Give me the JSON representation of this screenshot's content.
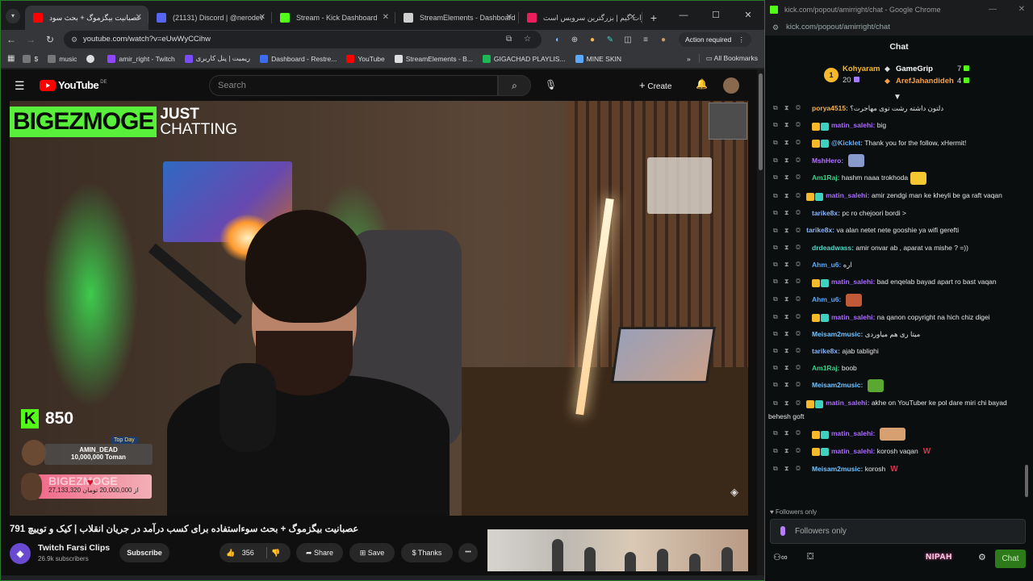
{
  "browser": {
    "tabs": [
      {
        "title": "عصبانیت بیگزموگ + بحث سود",
        "fav": "#ff0000",
        "active": true
      },
      {
        "title": "(21131) Discord | @nerodev",
        "fav": "#5865f2",
        "active": false
      },
      {
        "title": "Stream - Kick Dashboard",
        "fav": "#53fc18",
        "active": false
      },
      {
        "title": "StreamElements - Dashboard",
        "fav": "#cfcfcf",
        "active": false
      },
      {
        "title": "آپارات گیم | بزرگترین سرویس است",
        "fav": "#ea1d5d",
        "active": false
      }
    ],
    "newtab": "+",
    "win_min": "—",
    "win_max": "☐",
    "win_close": "✕",
    "url": "youtube.com/watch?v=eUwWyCCihw",
    "action_required": "Action required",
    "bookmarks": [
      {
        "label": "$",
        "color": "#777"
      },
      {
        "label": "music",
        "color": "#777"
      },
      {
        "label": "",
        "color": "#ddd"
      },
      {
        "label": "amir_right - Twitch",
        "color": "#9146ff"
      },
      {
        "label": "ریمیت | پنل کاربری",
        "color": "#7b4bff"
      },
      {
        "label": "Dashboard - Restre...",
        "color": "#3d6cf2"
      },
      {
        "label": "YouTube",
        "color": "#ff0000"
      },
      {
        "label": "StreamElements - B...",
        "color": "#ddd"
      },
      {
        "label": "GIGACHAD PLAYLIS...",
        "color": "#1db954"
      },
      {
        "label": "MINE SKIN",
        "color": "#5aa8ff"
      }
    ],
    "bookmarks_more": "»",
    "all_bookmarks": "All Bookmarks"
  },
  "youtube": {
    "logo": "YouTube",
    "country": "DE",
    "search_placeholder": "Search",
    "create": "Create",
    "video_title": "عصبانیت بیگزموگ + بحث سوءاستفاده برای کسب درآمد در جریان انقلاب | کیک و توییچ 791",
    "channel_name": "Twitch Farsi Clips",
    "channel_subs": "26.9k subscribers",
    "subscribe": "Subscribe",
    "likes": "356",
    "share": "Share",
    "save": "Save",
    "thanks": "Thanks",
    "more": "•••"
  },
  "overlay": {
    "brand": "BIGEZMOGE",
    "just": "JUST",
    "chatting": "CHATTING",
    "kick_followers": "850",
    "top_day_label": "Top Day",
    "top_day_name": "AMIN_DEAD",
    "top_day_amount": "10,000,000 Toman",
    "donate_text": "27,133,320 از 20,000,000 تومان",
    "donate_brand": "BIGEZMOGE"
  },
  "kick": {
    "window_title": "kick.com/popout/amirright/chat - Google Chrome",
    "url": "kick.com/popout/amirright/chat",
    "chat_title": "Chat",
    "leaderboard": [
      {
        "rank": "1",
        "name": "Kohyaram",
        "count": "20",
        "color": "#f6b92b"
      },
      {
        "name": "GameGrip",
        "count": "7",
        "color": "#ffffff"
      },
      {
        "name": "ArefJahandideh",
        "count": "4",
        "color": "#f5a046"
      }
    ],
    "messages": [
      {
        "user": "porya4515:",
        "color": "#f2b14a",
        "text": "دلتون داشته رشت توی مهاجرت؟",
        "badges": 0
      },
      {
        "user": "matin_salehi:",
        "color": "#a96bff",
        "text": "big",
        "badges": 2
      },
      {
        "user": "@Kicklet:",
        "color": "#60b0ff",
        "text": "Thank you for the follow, xHermit!",
        "badges": 2
      },
      {
        "user": "MshHero:",
        "color": "#b070ff",
        "text": "",
        "badges": 0,
        "emote": "#8899cc"
      },
      {
        "user": "Am1Raj:",
        "color": "#35d28a",
        "text": "hashm naaa trokhoda",
        "badges": 0,
        "emote": "#f5c832"
      },
      {
        "user": "matin_salehi:",
        "color": "#a96bff",
        "text": "amir zendgi man ke kheyli be ga raft vaqan",
        "badges": 2
      },
      {
        "user": "tarike8x:",
        "color": "#8ab4f8",
        "text": "pc ro chejoori bordi >",
        "badges": 0
      },
      {
        "user": "tarike8x:",
        "color": "#8ab4f8",
        "text": "va alan netet nete gooshie ya wifi gerefti",
        "badges": 0
      },
      {
        "user": "drdeadwass:",
        "color": "#4fd8c8",
        "text": "amir onvar ab , aparat va mishe ? =))",
        "badges": 0
      },
      {
        "user": "Ahm_u6:",
        "color": "#5aa8ff",
        "text": "اره",
        "badges": 0
      },
      {
        "user": "matin_salehi:",
        "color": "#a96bff",
        "text": "bad enqelab bayad apart ro bast vaqan",
        "badges": 2
      },
      {
        "user": "Ahm_u6:",
        "color": "#5aa8ff",
        "text": "",
        "badges": 0,
        "emote": "#c25a3a"
      },
      {
        "user": "matin_salehi:",
        "color": "#a96bff",
        "text": "na qanon copyright na hich chiz digei",
        "badges": 2
      },
      {
        "user": "Meisam2music:",
        "color": "#72c2ff",
        "text": "میتا ری هم میاوردی",
        "badges": 0
      },
      {
        "user": "tarike8x:",
        "color": "#8ab4f8",
        "text": "ajab tablighi",
        "badges": 0
      },
      {
        "user": "Am1Raj:",
        "color": "#35d28a",
        "text": "boob",
        "badges": 0
      },
      {
        "user": "Meisam2music:",
        "color": "#72c2ff",
        "text": "",
        "badges": 0,
        "emote": "#5aa832"
      },
      {
        "user": "matin_salehi:",
        "color": "#a96bff",
        "text": "akhe on YouTuber ke pol dare miri chi bayad behesh goft",
        "badges": 2
      },
      {
        "user": "matin_salehi:",
        "color": "#a96bff",
        "text": "",
        "badges": 2,
        "emote": "#d7a070"
      },
      {
        "user": "matin_salehi:",
        "color": "#a96bff",
        "text": "korosh vaqan",
        "badges": 2,
        "emote_w": "W"
      },
      {
        "user": "Meisam2music:",
        "color": "#72c2ff",
        "text": "korosh",
        "badges": 0,
        "emote_w": "W"
      }
    ],
    "followers_note": "♥ Followers only",
    "input_placeholder": "Followers only",
    "nipah": "NIPAH",
    "send": "Chat"
  },
  "colors": {
    "kick_green": "#53fc18",
    "yt_red": "#ff0000"
  }
}
